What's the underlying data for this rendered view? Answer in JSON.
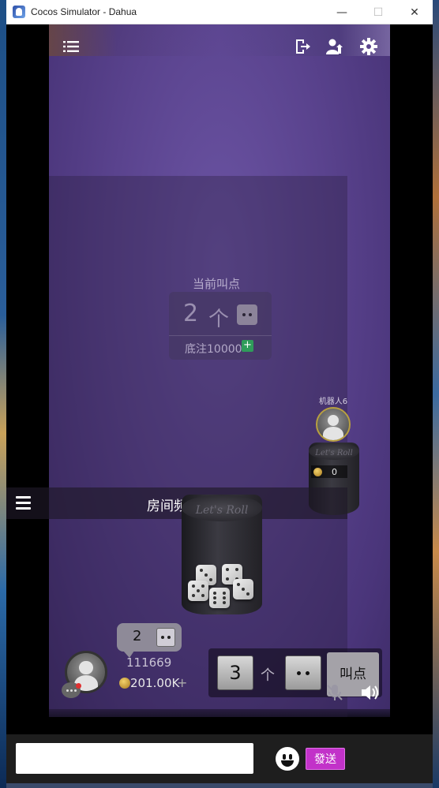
{
  "window": {
    "title": "Cocos Simulator - Dahua",
    "minimize_glyph": "—",
    "maximize_glyph": "☐",
    "close_glyph": "✕"
  },
  "top_icons": [
    "menu-list-icon",
    "exit-icon",
    "add-user-icon",
    "gear-icon"
  ],
  "current_call": {
    "label": "当前叫点",
    "count": "2",
    "unit": "个",
    "face": 2,
    "ante_label": "底注10000",
    "ante_plus": "+"
  },
  "robot_player": {
    "name": "机器人6",
    "cup_logo": "Let's Roll",
    "score": "0"
  },
  "room_channel": {
    "title": "房间频道"
  },
  "my_player": {
    "cup_logo": "Let's Roll",
    "bid_count": "2",
    "bid_face": 2,
    "id": "111669",
    "coins": "201.00K",
    "coins_plus": "+"
  },
  "bid_controls": {
    "quantity": "3",
    "unit": "个",
    "face": 2,
    "call_button": "叫点"
  },
  "chat_bar": {
    "input_value": "",
    "input_placeholder": "",
    "send_button": "發送"
  },
  "colors": {
    "table_purple": "#5a438e",
    "send_button": "#c232c9",
    "ante_plus": "#2f9c5a"
  }
}
